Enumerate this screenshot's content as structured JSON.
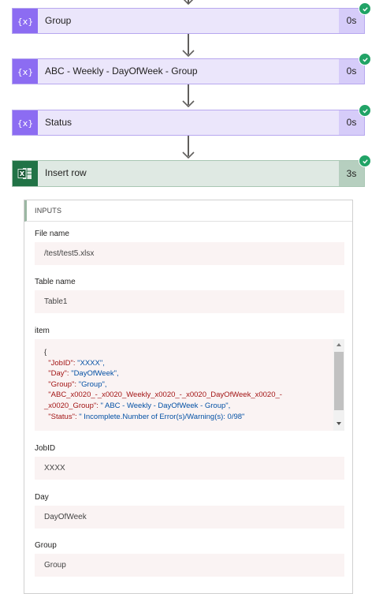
{
  "steps": [
    {
      "title": "Group",
      "duration": "0s"
    },
    {
      "title": "ABC - Weekly - DayOfWeek - Group",
      "duration": "0s"
    },
    {
      "title": "Status",
      "duration": "0s"
    },
    {
      "title": "Insert row",
      "duration": "3s"
    }
  ],
  "panel": {
    "header": "INPUTS",
    "file_name": {
      "label": "File name",
      "value": "/test/test5.xlsx"
    },
    "table_name": {
      "label": "Table name",
      "value": "Table1"
    },
    "item": {
      "label": "item",
      "lines": [
        {
          "key": "{",
          "value": ""
        },
        {
          "key": "  \"JobID\": ",
          "value": "\"XXXX\","
        },
        {
          "key": "  \"Day\": ",
          "value": "\"DayOfWeek\","
        },
        {
          "key": "  \"Group\": ",
          "value": "\"Group\","
        },
        {
          "key": "  \"ABC_x0020_-_x0020_Weekly_x0020_-_x0020_DayOfWeek_x0020_-",
          "value": ""
        },
        {
          "key": "_x0020_Group\": ",
          "value": "\" ABC - Weekly - DayOfWeek - Group\","
        },
        {
          "key": "  \"Status\": ",
          "value": "\" Incomplete.Number of Error(s)/Warning(s): 0/98\""
        }
      ]
    },
    "jobid": {
      "label": "JobID",
      "value": "XXXX"
    },
    "day": {
      "label": "Day",
      "value": "DayOfWeek"
    },
    "group": {
      "label": "Group",
      "value": "Group"
    }
  },
  "colors": {
    "variable_accent": "#8c6cf2",
    "excel_accent": "#217346",
    "success": "#21a366"
  },
  "icons": [
    "variable-icon",
    "excel-icon",
    "success-check-icon",
    "down-arrow-icon"
  ]
}
